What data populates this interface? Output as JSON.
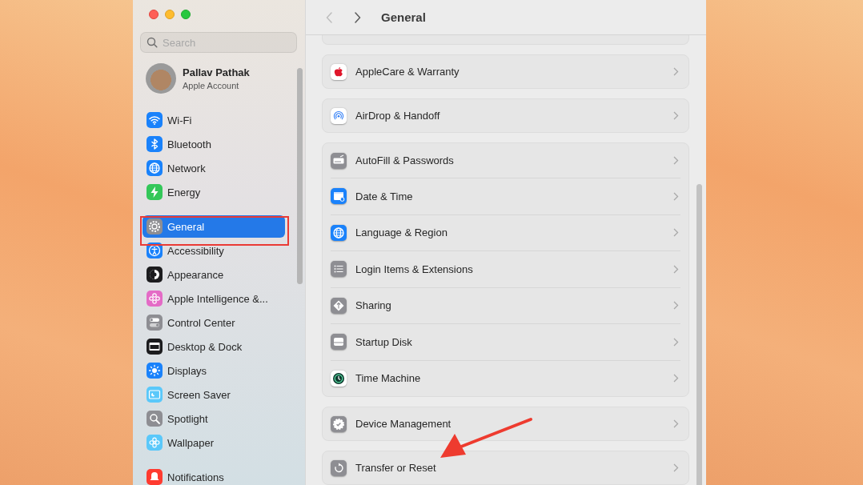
{
  "window": {
    "title": "General"
  },
  "navigation": {
    "back_disabled": true,
    "forward_disabled": false
  },
  "sidebar": {
    "search": {
      "placeholder": "Search"
    },
    "account": {
      "name": "Pallav Pathak",
      "subtitle": "Apple Account"
    },
    "groups": [
      [
        {
          "label": "Wi-Fi",
          "color": "#1a82fb",
          "selected": false
        },
        {
          "label": "Bluetooth",
          "color": "#1a82fb",
          "selected": false
        },
        {
          "label": "Network",
          "color": "#1a82fb",
          "selected": false
        },
        {
          "label": "Energy",
          "color": "#34c759",
          "selected": false
        }
      ],
      [
        {
          "label": "General",
          "color": "#8e8e93",
          "selected": true
        },
        {
          "label": "Accessibility",
          "color": "#1a82fb",
          "selected": false
        },
        {
          "label": "Appearance",
          "color": "#1c1c1e",
          "selected": false
        },
        {
          "label": "Apple Intelligence &...",
          "color": "#e46bc6",
          "selected": false
        },
        {
          "label": "Control Center",
          "color": "#8e8e93",
          "selected": false
        },
        {
          "label": "Desktop & Dock",
          "color": "#1c1c1e",
          "selected": false
        },
        {
          "label": "Displays",
          "color": "#1a82fb",
          "selected": false
        },
        {
          "label": "Screen Saver",
          "color": "#5ac8fa",
          "selected": false
        },
        {
          "label": "Spotlight",
          "color": "#8e8e93",
          "selected": false
        },
        {
          "label": "Wallpaper",
          "color": "#5ac8fa",
          "selected": false
        }
      ],
      [
        {
          "label": "Notifications",
          "color": "#ff3b30",
          "selected": false
        }
      ]
    ]
  },
  "main": {
    "groups": [
      [
        {
          "label": "AppleCare & Warranty",
          "color": "#ffffff"
        }
      ],
      [
        {
          "label": "AirDrop & Handoff",
          "color": "#ffffff"
        }
      ],
      [
        {
          "label": "AutoFill & Passwords",
          "color": "#8e8e93"
        },
        {
          "label": "Date & Time",
          "color": "#1a82fb"
        },
        {
          "label": "Language & Region",
          "color": "#1a82fb"
        },
        {
          "label": "Login Items & Extensions",
          "color": "#8e8e93"
        },
        {
          "label": "Sharing",
          "color": "#8e8e93"
        },
        {
          "label": "Startup Disk",
          "color": "#8e8e93"
        },
        {
          "label": "Time Machine",
          "color": "#ffffff"
        }
      ],
      [
        {
          "label": "Device Management",
          "color": "#8e8e93"
        }
      ],
      [
        {
          "label": "Transfer or Reset",
          "color": "#8e8e93"
        }
      ]
    ]
  }
}
